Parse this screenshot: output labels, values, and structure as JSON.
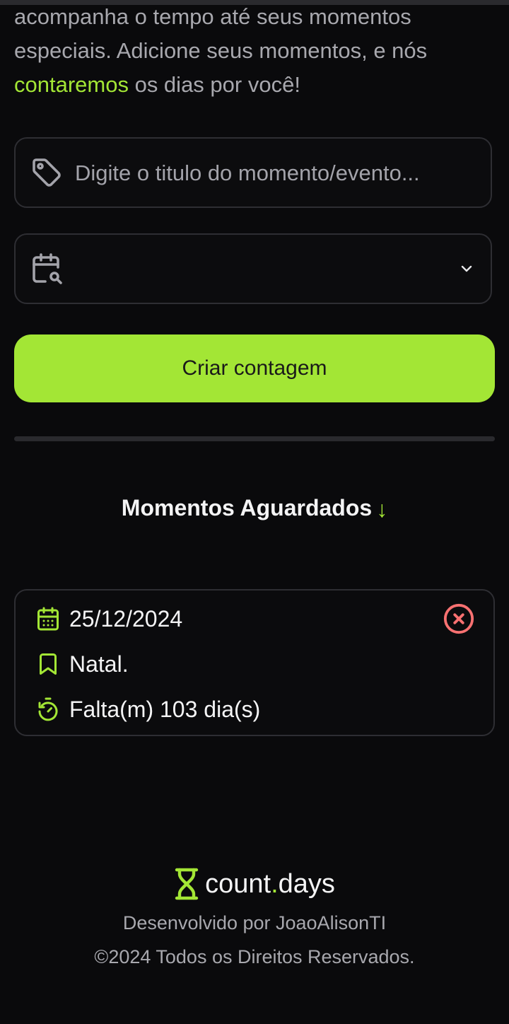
{
  "intro": {
    "line1": "acompanha o tempo até seus momentos",
    "line2": "especiais. Adicione seus momentos, e nós",
    "highlight": "contaremos",
    "line3_rest": " os dias por você!"
  },
  "form": {
    "title_placeholder": "Digite o titulo do momento/evento...",
    "date_value": "",
    "submit_label": "Criar contagem"
  },
  "section": {
    "title": "Momentos Aguardados",
    "arrow": "↓"
  },
  "moments": [
    {
      "date": "25/12/2024",
      "title": "Natal.",
      "remaining": "Falta(m) 103 dia(s)"
    }
  ],
  "footer": {
    "brand_main": "count",
    "brand_dot": ".",
    "brand_suffix": "days",
    "credit": "Desenvolvido por JoaoAlisonTI",
    "copyright": "©2024 Todos os Direitos Reservados."
  },
  "colors": {
    "accent": "#a3e635",
    "background": "#0a0a0c",
    "danger": "#f87171",
    "muted_text": "#a8a8ae"
  },
  "icons": {
    "title_field": "tag-icon",
    "date_field": "calendar-search-icon",
    "dropdown": "chevron-down-icon",
    "moment_date": "calendar-icon",
    "moment_title": "bookmark-icon",
    "moment_remaining": "timer-icon",
    "moment_delete": "circle-x-icon",
    "brand": "hourglass-icon"
  }
}
